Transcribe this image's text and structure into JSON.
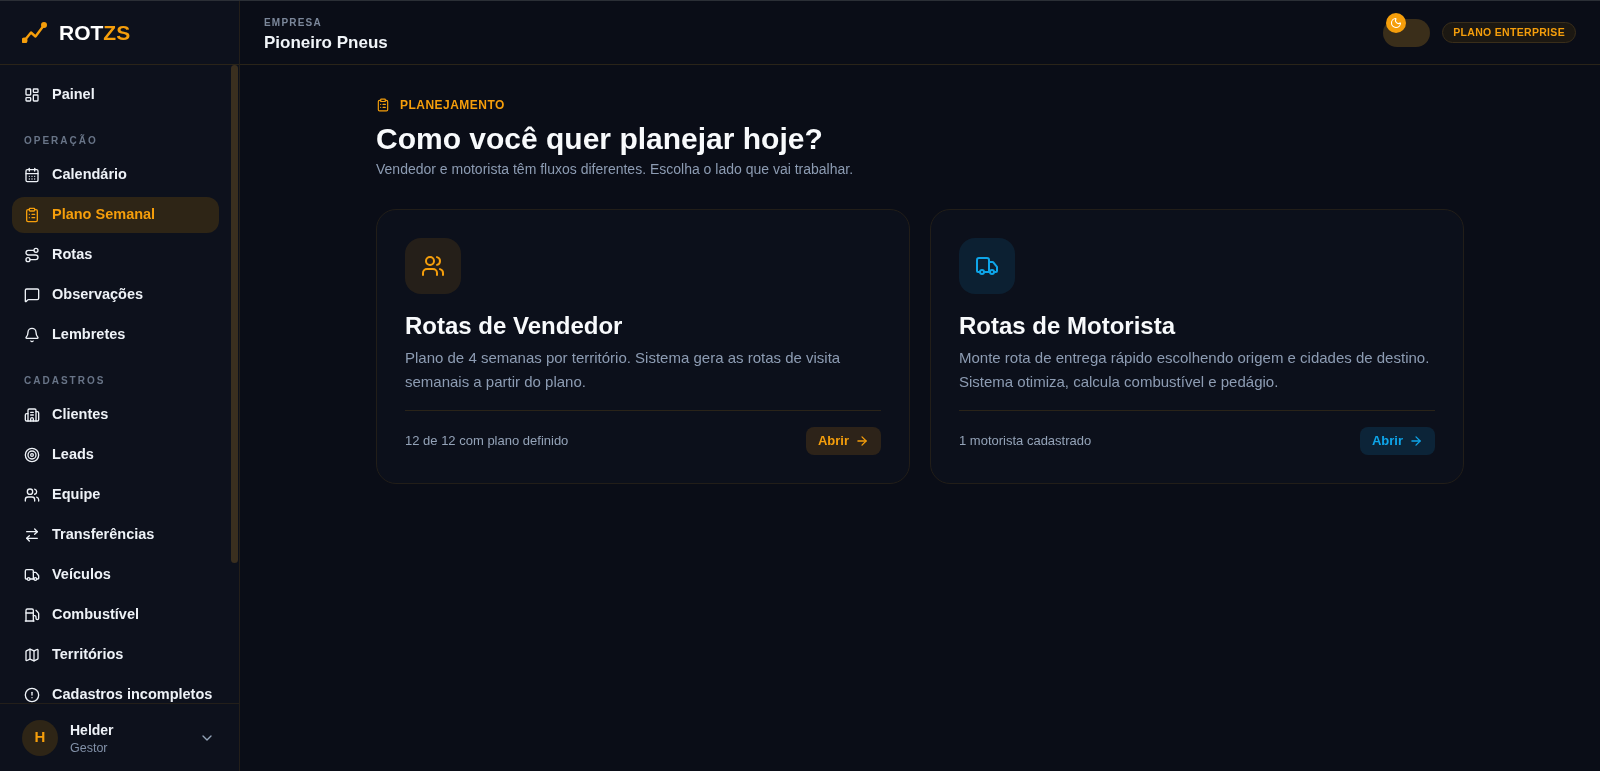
{
  "sidebar": {
    "brand": {
      "name": "ROT",
      "accent": "ZS"
    },
    "nav_groups": [
      {
        "items": [
          {
            "label": "Painel",
            "selected": false
          }
        ]
      },
      {
        "title": "OPERAÇÃO",
        "items": [
          {
            "label": "Calendário",
            "selected": false
          },
          {
            "label": "Plano Semanal",
            "selected": true
          },
          {
            "label": "Rotas",
            "selected": false
          },
          {
            "label": "Observações",
            "selected": false
          },
          {
            "label": "Lembretes",
            "selected": false
          }
        ]
      },
      {
        "title": "CADASTROS",
        "items": [
          {
            "label": "Clientes",
            "selected": false
          },
          {
            "label": "Leads",
            "selected": false
          },
          {
            "label": "Equipe",
            "selected": false
          },
          {
            "label": "Transferências",
            "selected": false
          },
          {
            "label": "Veículos",
            "selected": false
          },
          {
            "label": "Combustível",
            "selected": false
          },
          {
            "label": "Territórios",
            "selected": false
          },
          {
            "label": "Cadastros incompletos",
            "selected": false
          }
        ]
      }
    ],
    "user": {
      "initial": "H",
      "name": "Helder",
      "role": "Gestor"
    }
  },
  "header": {
    "company_label": "EMPRESA",
    "company_name": "Pioneiro Pneus",
    "theme_toggle": {
      "dark": true
    },
    "plan_badge": "PLANO ENTERPRISE"
  },
  "page": {
    "eyebrow": "PLANEJAMENTO",
    "title": "Como você quer planejar hoje?",
    "subtitle": "Vendedor e motorista têm fluxos diferentes. Escolha o lado que vai trabalhar.",
    "cards": [
      {
        "title": "Rotas de Vendedor",
        "description": "Plano de 4 semanas por território. Sistema gera as rotas de visita semanais a partir do plano.",
        "footer": "12 de 12 com plano definido",
        "button": "Abrir",
        "color": "#f59e0b"
      },
      {
        "title": "Rotas de Motorista",
        "description": "Monte rota de entrega rápido escolhendo origem e cidades de destino. Sistema otimiza, calcula combustível e pedágio.",
        "footer": "1 motorista cadastrado",
        "button": "Abrir",
        "color": "#0ea5e9"
      }
    ]
  }
}
